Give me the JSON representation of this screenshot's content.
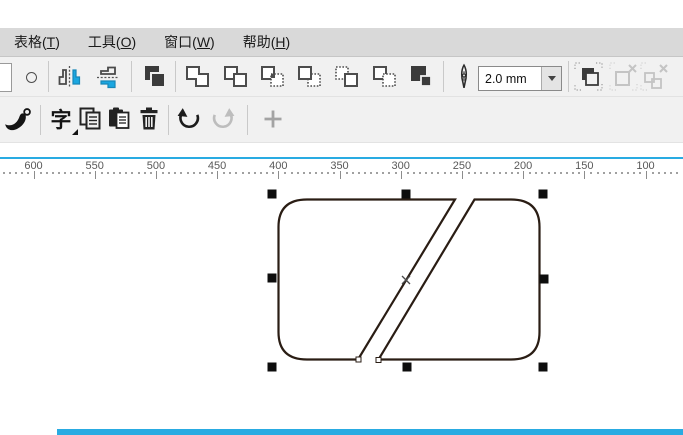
{
  "menu_bar": {
    "items": [
      {
        "pre": "表格(",
        "key": "T",
        "post": ")"
      },
      {
        "pre": "工具(",
        "key": "O",
        "post": ")"
      },
      {
        "pre": "窗口(",
        "key": "W",
        "post": ")"
      },
      {
        "pre": "帮助(",
        "key": "H",
        "post": ")"
      }
    ]
  },
  "toolbar_row1": {
    "outline_width": {
      "value": "2.0 mm"
    },
    "icon_names": [
      "color-swatch-partial",
      "ellipse-tool",
      "mirror-horizontal",
      "mirror-vertical",
      "combine",
      "weld",
      "trim",
      "intersect",
      "simplify",
      "front-minus-back",
      "back-minus-front",
      "create-boundary",
      "outline-pen",
      "outline-width-dropdown",
      "powerclip-frame",
      "ungroup",
      "ungroup-all"
    ]
  },
  "toolbar_row2": {
    "icon_names": [
      "artistic-media",
      "text-properties",
      "copy",
      "paste",
      "delete",
      "undo",
      "redo",
      "add"
    ]
  },
  "ruler": {
    "unit_labels": [
      600,
      550,
      500,
      450,
      400,
      350,
      300,
      250,
      200,
      150,
      100
    ]
  },
  "canvas": {
    "selection": {
      "handles": 8,
      "nodes": 2,
      "shape": "rounded rectangle split by diagonal slash"
    }
  },
  "colors": {
    "accent_blue": "#29abe2",
    "icon_blue": "#1aa6e0",
    "menu_bg": "#d9d9d9",
    "toolbar_bg": "#f1f1f1",
    "shape_stroke": "#2a1d14",
    "disabled_gray": "#c4c4c4",
    "ruler_text": "#595959"
  }
}
